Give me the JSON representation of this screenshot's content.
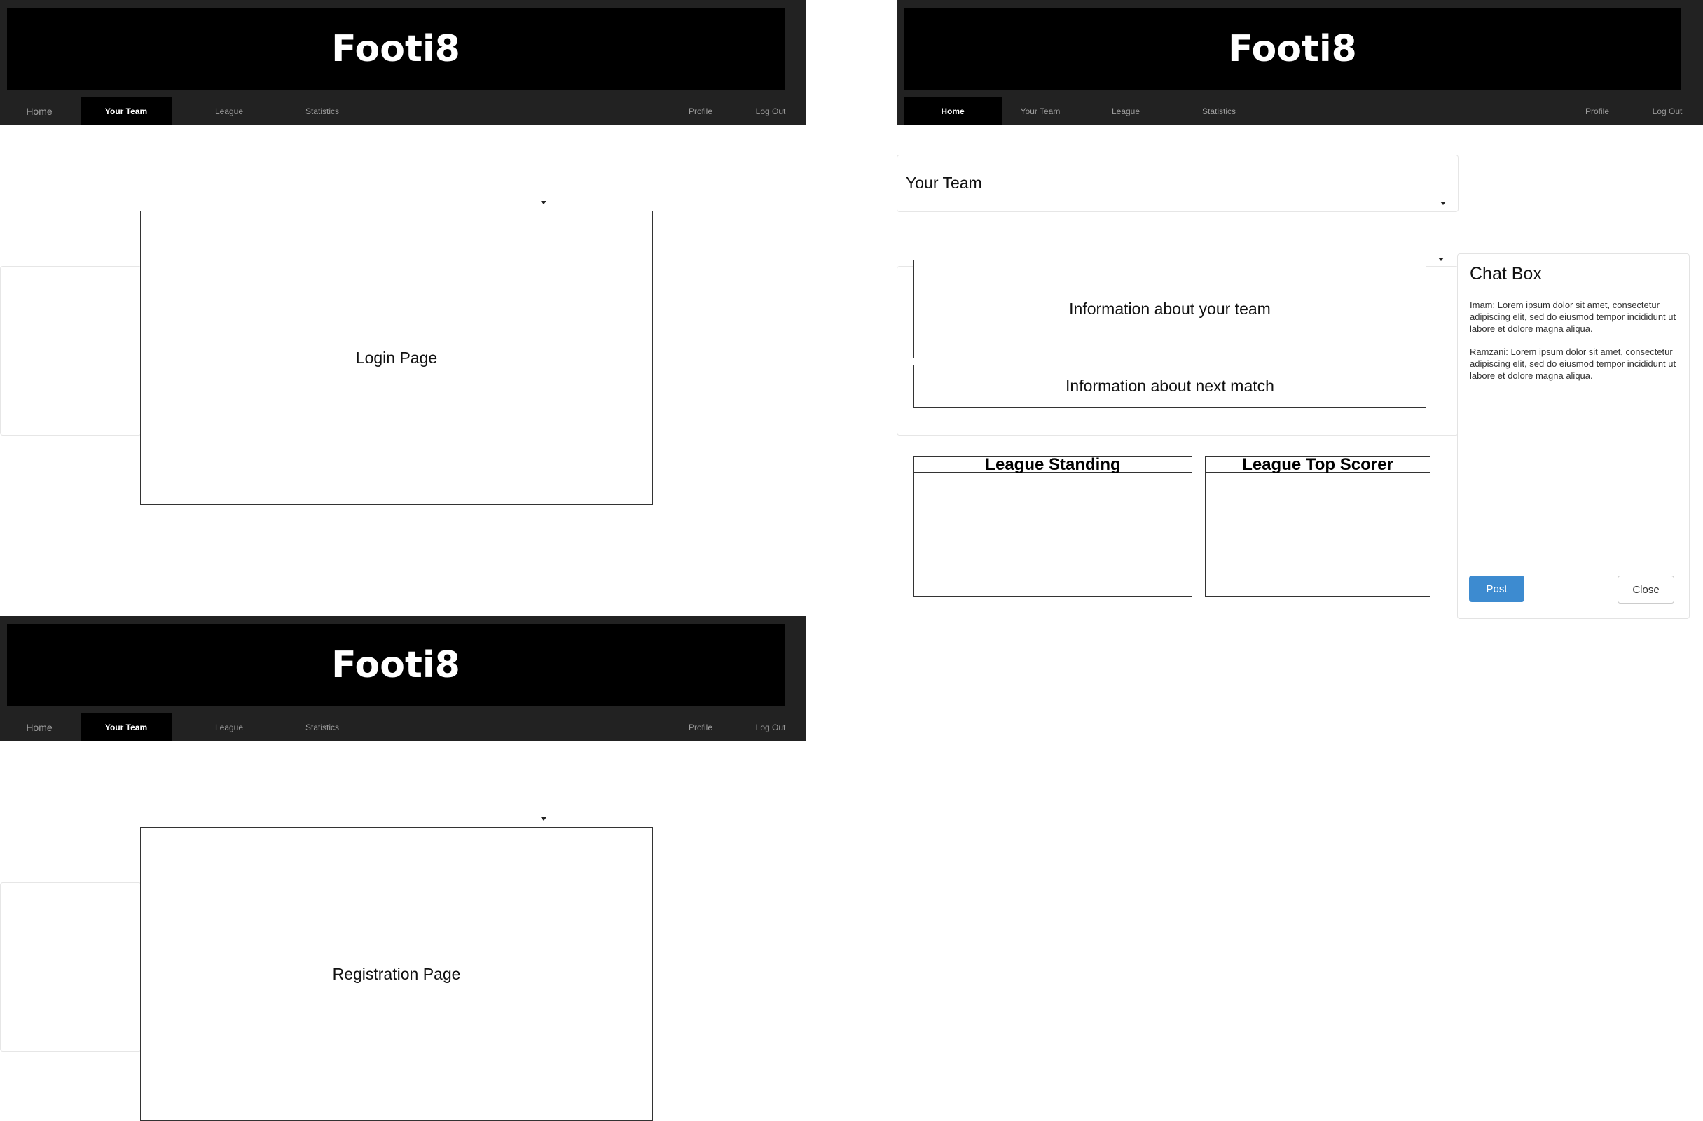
{
  "brand": "Footi8",
  "nav": {
    "home": "Home",
    "your_team": "Your Team",
    "league": "League",
    "statistics": "Statistics",
    "profile": "Profile",
    "logout": "Log Out"
  },
  "login_screen": {
    "active_tab": "Your Team",
    "box_label": "Login Page"
  },
  "registration_screen": {
    "active_tab": "Your Team",
    "box_label": "Registration Page"
  },
  "home_screen": {
    "active_tab": "Home",
    "team_select_value": "Your Team",
    "team_info": "Information about your team",
    "next_match_info": "Information about next match",
    "league_standing_title": "League Standing",
    "league_top_scorer_title": "League Top Scorer",
    "chat": {
      "title": "Chat Box",
      "messages": [
        "Imam: Lorem ipsum dolor sit amet, consectetur adipiscing elit, sed do eiusmod tempor incididunt ut labore et dolore magna aliqua.",
        "Ramzani: Lorem ipsum dolor sit amet, consectetur adipiscing elit, sed do eiusmod tempor incididunt ut labore et dolore magna aliqua."
      ],
      "post_label": "Post",
      "close_label": "Close"
    }
  },
  "colors": {
    "header_bg": "#222222",
    "banner_bg": "#000000",
    "nav_text": "#9d9d9d",
    "post_button": "#3d8bd0"
  }
}
